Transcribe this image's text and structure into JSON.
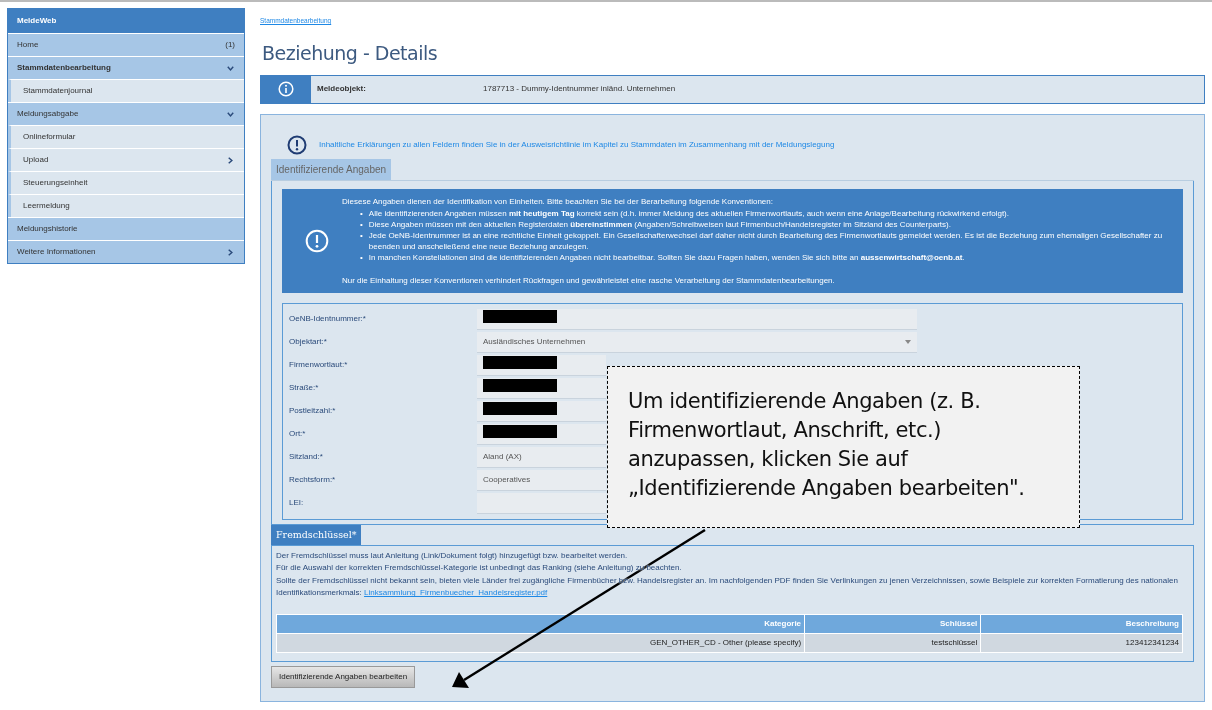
{
  "sidebar": {
    "title": "MeldeWeb",
    "items": [
      {
        "label": "Home",
        "count": "(1)",
        "selected": false
      },
      {
        "label": "Stammdatenbearbeitung",
        "selected": true,
        "expanded": true,
        "children": [
          {
            "label": "Stammdatenjournal",
            "selected": false
          }
        ]
      },
      {
        "label": "Meldungsabgabe",
        "selected": false,
        "expanded": true,
        "children": [
          {
            "label": "Onlineformular",
            "selected": false
          },
          {
            "label": "Upload",
            "selected": false,
            "expanded": false
          },
          {
            "label": "Steuerungseinheit",
            "selected": false
          },
          {
            "label": "Leermeldung",
            "selected": false
          }
        ]
      },
      {
        "label": "Meldungshistorie",
        "selected": false
      },
      {
        "label": "Weitere Informationen",
        "selected": false,
        "expanded": false
      }
    ]
  },
  "breadcrumb": "Stammdatenbearbeitung",
  "page_title": "Beziehung - Details",
  "meldeobjekt": {
    "label": "Meldeobjekt:",
    "value": "1787713 - Dummy-Identnummer inländ. Unternehmen"
  },
  "hint": "Inhaltliche Erklärungen zu allen Feldern finden Sie in der Ausweisrichtlinie im Kapitel zu Stammdaten im Zusammenhang mit der Meldungslegung",
  "identifying": {
    "legend": "Identifizierende Angaben",
    "notice": {
      "bullet_marker": "•",
      "intro": "Diesese Angaben dienen der Identifikation von Einheiten. Bitte beachten Sie bei der Berarbeitung folgende Konventionen:",
      "bullets": [
        "Alle identifizierenden Angaben müssen **mit heutigem Tag** korrekt sein (d.h. immer Meldung des aktuellen Firmenwortlauts, auch wenn eine Anlage/Bearbeitung rückwirkend erfolgt).",
        "Diese Angaben müssen mit den aktuellen Registerdaten **übereinstimmen** (Angaben/Schreibweisen laut Firmenbuch/Handelsregister im Sitzland des Counterparts).",
        "Jede OeNB-Identnummer ist an eine rechtliche Einheit gekoppelt. Ein Gesellschafterwechsel darf daher nicht durch Bearbeitung des Firmenwortlauts gemeldet werden. Es ist die Beziehung zum ehemaligen Gesellschafter zu beenden und anscheließend eine neue Beziehung anzulegen.",
        "In manchen Konstellationen sind die identifizierenden Angaben nicht bearbeitbar. Sollten Sie dazu Fragen haben, wenden Sie sich bitte an **aussenwirtschaft@oenb.at**."
      ],
      "outro": "Nur die Einhaltung dieser Konventionen verhindert Rückfragen und gewährleistet eine rasche Verarbeitung der Stammdatenbearbeitungen."
    },
    "fields": [
      {
        "label": "OeNB-Identnummer:*",
        "kind": "text",
        "redacted": true
      },
      {
        "label": "Objektart:*",
        "kind": "select",
        "value": "Ausländisches Unternehmen",
        "redacted": false
      },
      {
        "label": "Firmenwortlaut:*",
        "kind": "text",
        "redacted": true
      },
      {
        "label": "Straße:*",
        "kind": "text",
        "redacted": true
      },
      {
        "label": "Postleitzahl:*",
        "kind": "text",
        "redacted": true
      },
      {
        "label": "Ort:*",
        "kind": "text",
        "redacted": true
      },
      {
        "label": "Sitzland:*",
        "kind": "text",
        "value": "Aland (AX)",
        "redacted": false
      },
      {
        "label": "Rechtsform:*",
        "kind": "text",
        "value": "Cooperatives",
        "redacted": false
      },
      {
        "label": "LEI:",
        "kind": "text",
        "redacted": false
      }
    ]
  },
  "foreign_key": {
    "legend": "Fremdschlüssel*",
    "paragraphs": [
      {
        "text": "Der Fremdschlüssel muss laut Anleitung (Link/Dokument folgt) hinzugefügt bzw. bearbeitet werden."
      },
      {
        "text": "Für die Auswahl der korrekten Fremdschlüssel-Kategorie ist unbedingt das Ranking (siehe Anleitung) zu beachten."
      },
      {
        "text": "Sollte der Fremdschlüssel nicht bekannt sein, bieten viele Länder frei zugängliche Firmenbücher bzw. Handelsregister an. Im nachfolgenden PDF finden Sie Verlinkungen zu jenen Verzeichnissen, sowie Beispiele zur korrekten Formatierung des nationalen Identifikationsmerkmals:",
        "link": "Linksammlung_Firmenbuecher_Handelsregister.pdf"
      }
    ],
    "table": {
      "columns": [
        "Kategorie",
        "Schlüssel",
        "Beschreibung"
      ],
      "rows": [
        [
          "GEN_OTHER_CD - Other (please specify)",
          "testschlüssel",
          "123412341234"
        ]
      ]
    }
  },
  "edit_button": "Identifizierende Angaben bearbeiten",
  "callout": {
    "text": "Um identifizierende Angaben (z. B. Firmenwortlaut, Anschrift, etc.) anzupassen, klicken Sie auf „Identifizierende Angaben bearbeiten\"."
  }
}
